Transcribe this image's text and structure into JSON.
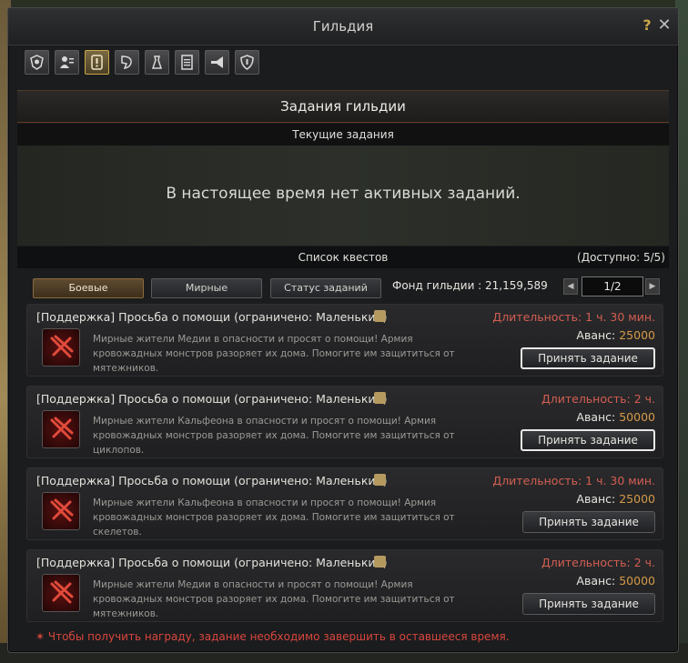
{
  "window": {
    "title": "Гильдия",
    "help_label": "?",
    "close_label": "✕"
  },
  "tabs": [
    {
      "icon": "guild-emblem-icon",
      "active": false
    },
    {
      "icon": "members-icon",
      "active": false
    },
    {
      "icon": "quest-alert-icon",
      "active": true
    },
    {
      "icon": "skills-icon",
      "active": false
    },
    {
      "icon": "contract-icon",
      "active": false
    },
    {
      "icon": "document-icon",
      "active": false
    },
    {
      "icon": "megaphone-icon",
      "active": false
    },
    {
      "icon": "shield-icon",
      "active": false
    }
  ],
  "section": {
    "title": "Задания гильдии",
    "current_header": "Текущие задания",
    "empty_text": "В настоящее время нет активных заданий."
  },
  "list": {
    "title": "Список квестов",
    "available": "(Доступно: 5/5)",
    "filters": [
      {
        "label": "Боевые",
        "active": true
      },
      {
        "label": "Мирные",
        "active": false
      },
      {
        "label": "Статус заданий",
        "active": false
      }
    ],
    "fund_label": "Фонд гильдии : 21,159,589",
    "page": "1/2",
    "prev_label": "◀",
    "next_label": "▶"
  },
  "quests": [
    {
      "title": "[Поддержка] Просьба о помощи (ограничено: Маленький)",
      "description": "Мирные жители Медии в опасности и просят о помощи! Армия кровожадных монстров разоряет их дома. Помогите им защититься от мятежников.",
      "duration": "Длительность: 1 ч. 30 мин.",
      "advance_label": "Аванс:",
      "advance_value": "25000",
      "button": "Принять задание",
      "focused": true
    },
    {
      "title": "[Поддержка] Просьба о помощи (ограничено: Маленький)",
      "description": "Мирные жители Кальфеона в опасности и просят о помощи! Армия кровожадных монстров разоряет их дома. Помогите им защититься от циклопов.",
      "duration": "Длительность: 2 ч.",
      "advance_label": "Аванс:",
      "advance_value": "50000",
      "button": "Принять задание",
      "focused": true
    },
    {
      "title": "[Поддержка] Просьба о помощи (ограничено: Маленький)",
      "description": "Мирные жители Кальфеона в опасности и просят о помощи! Армия кровожадных монстров разоряет их дома. Помогите им защититься от скелетов.",
      "duration": "Длительность: 1 ч. 30 мин.",
      "advance_label": "Аванс:",
      "advance_value": "25000",
      "button": "Принять задание",
      "focused": false
    },
    {
      "title": "[Поддержка] Просьба о помощи (ограничено: Маленький)",
      "description": "Мирные жители Медии в опасности и просят о помощи! Армия кровожадных монстров разоряет их дома. Помогите им защититься от мятежников.",
      "duration": "Длительность: 2 ч.",
      "advance_label": "Аванс:",
      "advance_value": "50000",
      "button": "Принять задание",
      "focused": false
    }
  ],
  "footnote": "✶ Чтобы получить награду, задание необходимо завершить в оставшееся время."
}
